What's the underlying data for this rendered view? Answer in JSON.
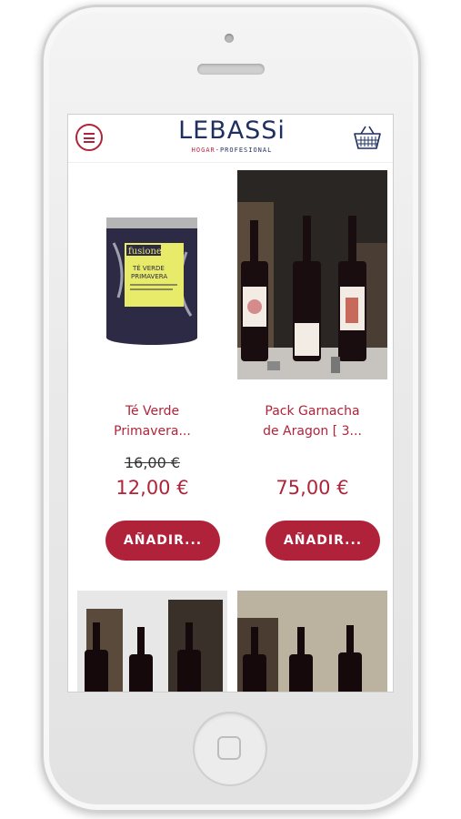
{
  "app": {
    "logo_text": "LEBASSi",
    "logo_sub_left": "HOGAR",
    "logo_sub_sep": "-",
    "logo_sub_right": "PROFESIONAL"
  },
  "icons": {
    "menu": "hamburger-icon",
    "cart": "shopping-basket-icon"
  },
  "colors": {
    "accent": "#b0213a",
    "brand_navy": "#1f2f5f"
  },
  "products": [
    {
      "name_line1": "Té Verde",
      "name_line2": "Primavera...",
      "old_price": "16,00 €",
      "price": "12,00 €",
      "button": "AÑADIR..."
    },
    {
      "name_line1": "Pack Garnacha",
      "name_line2": "de Aragon [ 3...",
      "old_price": "",
      "price": "75,00 €",
      "button": "AÑADIR..."
    }
  ]
}
